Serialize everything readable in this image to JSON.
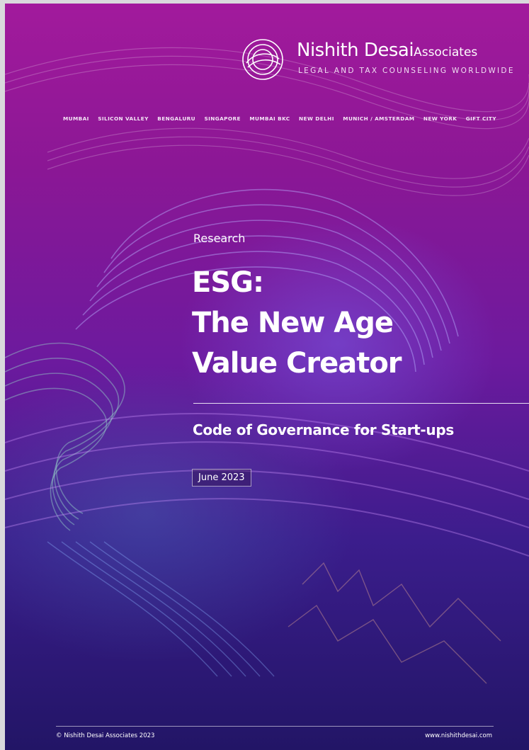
{
  "brand": {
    "name": "Nishith Desai",
    "name_suffix": "Associates",
    "tagline": "LEGAL AND TAX COUNSELING WORLDWIDE",
    "logo_icon": "nda-circular-monogram-icon"
  },
  "cities": [
    "MUMBAI",
    "SILICON VALLEY",
    "BENGALURU",
    "SINGAPORE",
    "MUMBAI BKC",
    "NEW DELHI",
    "MUNICH / AMSTERDAM",
    "NEW YORK",
    "GIFT CITY"
  ],
  "cover": {
    "eyebrow": "Research",
    "title_lines": [
      "ESG:",
      "The New Age",
      "Value Creator"
    ],
    "subtitle": "Code of Governance for Start-ups",
    "date": "June 2023"
  },
  "footer": {
    "copyright": "© Nishith Desai Associates 2023",
    "website": "www.nishithdesai.com"
  },
  "colors": {
    "background_top": "#a21a9c",
    "background_bottom": "#221566",
    "text": "#ffffff"
  }
}
